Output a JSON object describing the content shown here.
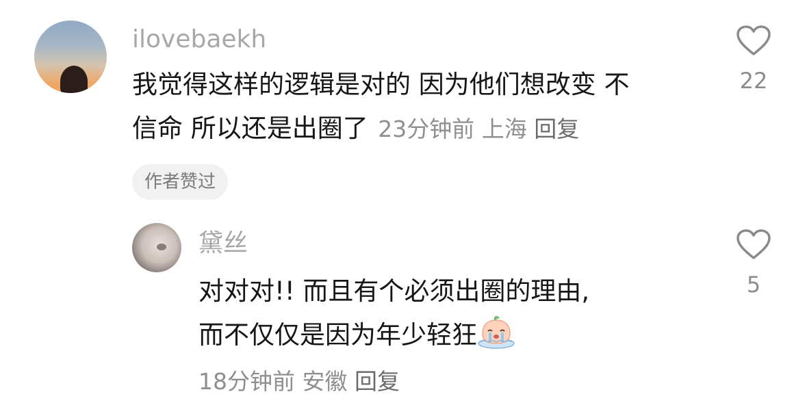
{
  "comment": {
    "username": "ilovebaekh",
    "text_line1": "我觉得这样的逻辑是对的 因为他们想改变 不",
    "text_line2": "信命 所以还是出圈了",
    "time": "23分钟前",
    "location": "上海",
    "reply_label": "回复",
    "author_liked_badge": "作者赞过",
    "like_count": "22"
  },
  "reply": {
    "username": "黛丝",
    "text_line1": "对对对!! 而且有个必须出圈的理由,",
    "text_line2": "而不仅仅是因为年少轻狂",
    "emoji_icon": "crying-peach-emoji",
    "time": "18分钟前",
    "location": "安徽",
    "reply_label": "回复",
    "like_count": "5"
  }
}
